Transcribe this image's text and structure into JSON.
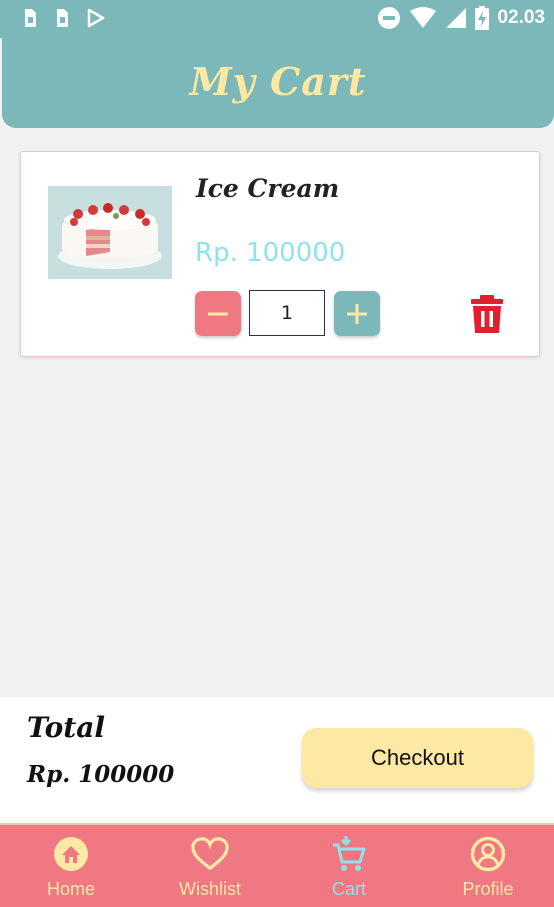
{
  "status_bar": {
    "time": "02.03",
    "icons": [
      "sim-icon",
      "sim-icon",
      "play-store-icon",
      "do-not-disturb-icon",
      "wifi-icon",
      "signal-icon",
      "battery-charging-icon"
    ]
  },
  "header": {
    "title": "My Cart"
  },
  "cart": {
    "items": [
      {
        "name": "Ice Cream",
        "price": "Rp. 100000",
        "quantity": "1",
        "image": "cake-image",
        "decrease_icon": "minus-icon",
        "increase_icon": "plus-icon",
        "delete_icon": "trash-icon"
      }
    ]
  },
  "summary": {
    "total_label": "Total",
    "total_value": "Rp. 100000",
    "checkout_label": "Checkout"
  },
  "bottom_nav": {
    "items": [
      {
        "label": "Home",
        "icon": "home-icon",
        "active": false
      },
      {
        "label": "Wishlist",
        "icon": "heart-icon",
        "active": false
      },
      {
        "label": "Cart",
        "icon": "cart-icon",
        "active": true
      },
      {
        "label": "Profile",
        "icon": "profile-icon",
        "active": false
      }
    ]
  },
  "colors": {
    "header_bg": "#7cb7ba",
    "title_text": "#fde8a4",
    "price_text": "#8fe3ea",
    "minus_button": "#ef7883",
    "plus_button": "#7cb7ba",
    "delete_icon": "#e0202e",
    "checkout_bg": "#fde8a4",
    "nav_bg": "#ef7883",
    "nav_label": "#fde8a4",
    "nav_active": "#8fe3ea"
  }
}
